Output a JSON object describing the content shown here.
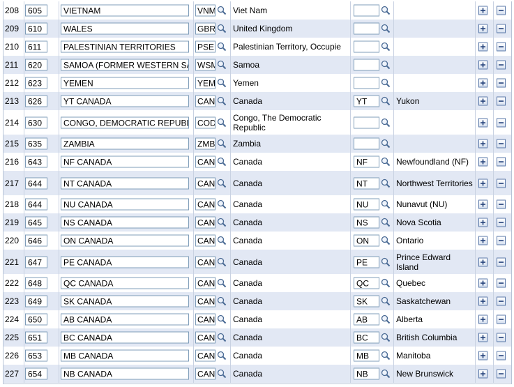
{
  "rows": [
    {
      "num": "208",
      "code": "605",
      "desc": "VIETNAM",
      "country": "VNM",
      "country_desc": "Viet Nam",
      "state": "",
      "state_desc": ""
    },
    {
      "num": "209",
      "code": "610",
      "desc": "WALES",
      "country": "GBR",
      "country_desc": "United Kingdom",
      "state": "",
      "state_desc": ""
    },
    {
      "num": "210",
      "code": "611",
      "desc": "PALESTINIAN TERRITORIES",
      "country": "PSE",
      "country_desc": "Palestinian Territory, Occupie",
      "state": "",
      "state_desc": ""
    },
    {
      "num": "211",
      "code": "620",
      "desc": "SAMOA (FORMER WESTERN SAM",
      "country": "WSM",
      "country_desc": "Samoa",
      "state": "",
      "state_desc": ""
    },
    {
      "num": "212",
      "code": "623",
      "desc": "YEMEN",
      "country": "YEM",
      "country_desc": "Yemen",
      "state": "",
      "state_desc": ""
    },
    {
      "num": "213",
      "code": "626",
      "desc": "YT CANADA",
      "country": "CAN",
      "country_desc": "Canada",
      "state": "YT",
      "state_desc": "Yukon"
    },
    {
      "num": "214",
      "code": "630",
      "desc": "CONGO, DEMOCRATIC REPUBLIC",
      "country": "COD",
      "country_desc": "Congo, The Democratic Republic",
      "state": "",
      "state_desc": ""
    },
    {
      "num": "215",
      "code": "635",
      "desc": "ZAMBIA",
      "country": "ZMB",
      "country_desc": "Zambia",
      "state": "",
      "state_desc": ""
    },
    {
      "num": "216",
      "code": "643",
      "desc": "NF CANADA",
      "country": "CAN",
      "country_desc": "Canada",
      "state": "NF",
      "state_desc": "Newfoundland (NF)"
    },
    {
      "num": "217",
      "code": "644",
      "desc": "NT CANADA",
      "country": "CAN",
      "country_desc": "Canada",
      "state": "NT",
      "state_desc": "Northwest Territories"
    },
    {
      "num": "218",
      "code": "644",
      "desc": "NU CANADA",
      "country": "CAN",
      "country_desc": "Canada",
      "state": "NU",
      "state_desc": "Nunavut (NU)"
    },
    {
      "num": "219",
      "code": "645",
      "desc": "NS CANADA",
      "country": "CAN",
      "country_desc": "Canada",
      "state": "NS",
      "state_desc": "Nova Scotia"
    },
    {
      "num": "220",
      "code": "646",
      "desc": "ON CANADA",
      "country": "CAN",
      "country_desc": "Canada",
      "state": "ON",
      "state_desc": "Ontario"
    },
    {
      "num": "221",
      "code": "647",
      "desc": "PE CANADA",
      "country": "CAN",
      "country_desc": "Canada",
      "state": "PE",
      "state_desc": "Prince Edward Island"
    },
    {
      "num": "222",
      "code": "648",
      "desc": "QC CANADA",
      "country": "CAN",
      "country_desc": "Canada",
      "state": "QC",
      "state_desc": "Quebec"
    },
    {
      "num": "223",
      "code": "649",
      "desc": "SK CANADA",
      "country": "CAN",
      "country_desc": "Canada",
      "state": "SK",
      "state_desc": "Saskatchewan"
    },
    {
      "num": "224",
      "code": "650",
      "desc": "AB CANADA",
      "country": "CAN",
      "country_desc": "Canada",
      "state": "AB",
      "state_desc": "Alberta"
    },
    {
      "num": "225",
      "code": "651",
      "desc": "BC CANADA",
      "country": "CAN",
      "country_desc": "Canada",
      "state": "BC",
      "state_desc": "British Columbia"
    },
    {
      "num": "226",
      "code": "653",
      "desc": "MB CANADA",
      "country": "CAN",
      "country_desc": "Canada",
      "state": "MB",
      "state_desc": "Manitoba"
    },
    {
      "num": "227",
      "code": "654",
      "desc": "NB CANADA",
      "country": "CAN",
      "country_desc": "Canada",
      "state": "NB",
      "state_desc": "New Brunswick"
    }
  ],
  "icons": {
    "lookup": "magnifier-icon",
    "add": "plus-icon",
    "delete": "minus-icon"
  },
  "colors": {
    "row_alt": "#e2e8f4",
    "input_border": "#7f9db9",
    "button_border": "#5a78a8"
  }
}
